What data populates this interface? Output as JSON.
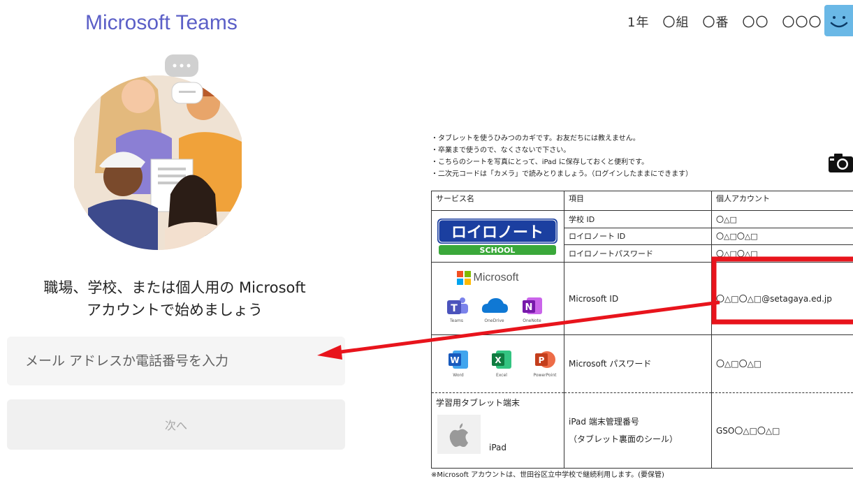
{
  "teams": {
    "title": "Microsoft Teams",
    "prompt_line1": "職場、学校、または個人用の Microsoft",
    "prompt_line2": "アカウントで始めましょう",
    "email_placeholder": "メール アドレスか電話番号を入力",
    "next_label": "次へ",
    "accent_color": "#5b5fc7"
  },
  "student": {
    "id_line": "1年　〇組　〇番　〇〇　〇〇〇"
  },
  "sheet": {
    "notes": [
      "・タブレットを使うひみつのカギです。お友だちには教えません。",
      "・卒業まで使うので、なくさないで下さい。",
      "・こちらのシートを写真にとって、iPad に保存しておくと便利です。",
      "・二次元コードは「カメラ」で読みとりましょう。（ログインしたままにできます）"
    ],
    "headers": {
      "service": "サービス名",
      "item": "項目",
      "account": "個人アカウント"
    },
    "loilo": {
      "logo_text": "ロイロノート",
      "school_text": "SCHOOL",
      "rows": [
        {
          "item": "学校 ID",
          "value": "〇△□"
        },
        {
          "item": "ロイロノート ID",
          "value": "〇△□〇△□"
        },
        {
          "item": "ロイロノートパスワード",
          "value": "〇△□〇△□"
        }
      ]
    },
    "microsoft": {
      "brand": "Microsoft",
      "apps": [
        "Teams",
        "OneDrive",
        "OneNote"
      ],
      "office_apps": [
        "Word",
        "Excel",
        "PowerPoint"
      ],
      "id_item": "Microsoft ID",
      "id_value": "〇△□〇△□@setagaya.ed.jp",
      "pw_item": "Microsoft パスワード",
      "pw_value": "〇△□〇△□"
    },
    "ipad": {
      "service": "学習用タブレット端末",
      "label": "iPad",
      "item_line1": "iPad 端末管理番号",
      "item_line2": "（タブレット裏面のシール）",
      "value": "GSO〇△□〇△□"
    },
    "footnote": "※Microsoft アカウントは、世田谷区立中学校で継続利用します。(要保管)"
  },
  "colors": {
    "highlight_red": "#e8141c",
    "loilo_blue": "#1b3fa0",
    "loilo_green": "#3aa83a"
  }
}
